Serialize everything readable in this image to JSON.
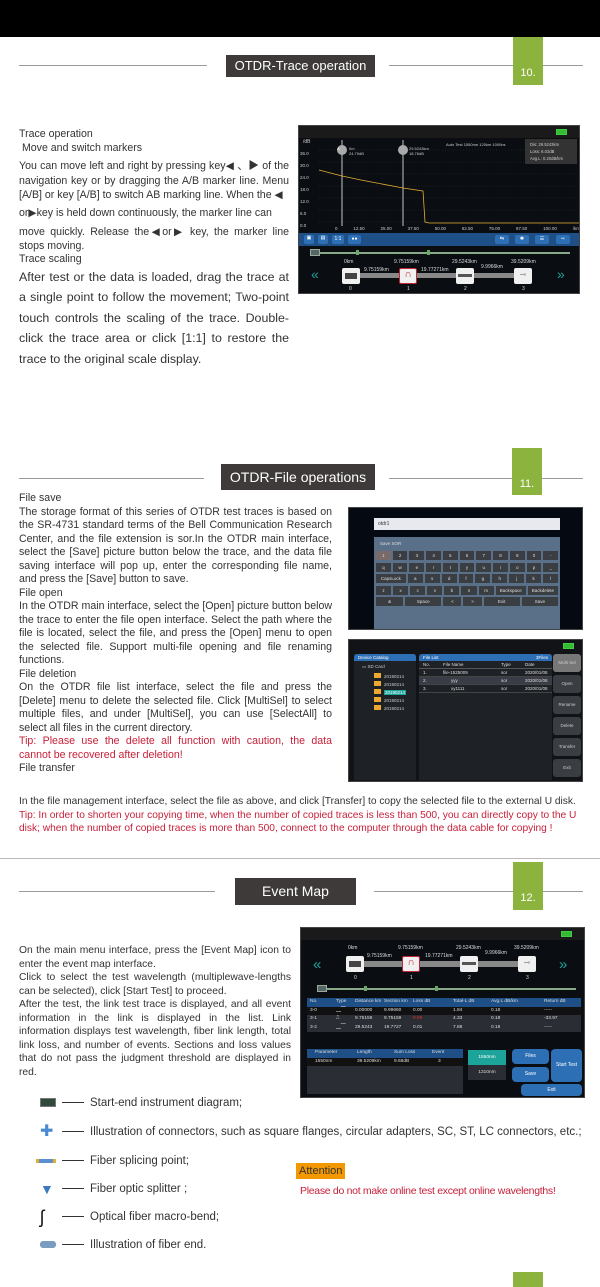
{
  "sections": [
    {
      "title": "OTDR-Trace operation",
      "page": "10."
    },
    {
      "title": "OTDR-File operations",
      "page": "11."
    },
    {
      "title": "Event Map",
      "page": "12."
    }
  ],
  "trace": {
    "h1": "Trace operation",
    "h2": " Move and switch markers",
    "p1": "You can move left and right by pressing key◀ 、▶ of the navigation key or by dragging the A/B marker line. Menu [A/B] or key [A/B] to switch AB marking line. When the ◀",
    "p2": "or▶key is held down continuously, the marker line can",
    "p3": "move quickly. Release the◀or▶ key, the marker line stops moving.",
    "h3": "Trace scaling",
    "p4": "After test or the data is loaded, drag the trace at a single point to follow the movement; Two-point touch controls the scaling of the trace. Double-click the trace area or click [1:1] to restore the trace to the original scale display."
  },
  "trace_screen": {
    "yunit": "/dB",
    "yticks": [
      "36.0",
      "30.0",
      "24.0",
      "18.0",
      "12.0",
      "6.0",
      "0.0"
    ],
    "xticks": [
      "0",
      "12.50",
      "25.00",
      "37.50",
      "50.00",
      "62.50",
      "75.00",
      "87.50",
      "100.00",
      "/km"
    ],
    "marker_a": {
      "label": "A",
      "dist": "0m",
      "loss": "24.79dB"
    },
    "marker_b": {
      "label": "B",
      "dist": "29.5243km",
      "loss": "18.76dB"
    },
    "test_info": "Auto Test  1550nm  120km  1000ns",
    "info_box": [
      "Dis: 29.5243km",
      "Loss: 6.03dB",
      "Avg.L: 0.20dB/km"
    ],
    "zoom_btn": "1:1",
    "colors": {
      "trace": "#e0b030",
      "marker": "#888888",
      "toolbar": "#1e4f86"
    }
  },
  "event_map": {
    "distances": [
      "0km",
      "9.75159km",
      "29.5243km",
      "39.5209km"
    ],
    "sections": [
      "9.75159km",
      "19.77271km",
      "9.9966km"
    ],
    "indices": [
      "0",
      "1",
      "2",
      "3"
    ]
  },
  "files": {
    "save_p": "File save",
    "p1": "The storage format of this series of OTDR test traces is based on the SR-4731 standard terms of the Bell Communication Research Center, and the file extension is sor.In the OTDR main interface, select the [Save] picture button below the trace, and the data file saving interface will pop up, enter the corresponding file name, and press the [Save] button to save.",
    "open_h": "File open",
    "p2": "In the OTDR main interface, select the [Open] picture button below the trace to enter the file open interface. Select the path where the file is located, select the file, and press the [Open] menu to open the selected file. Support multi-file opening and file renaming functions.",
    "del_h": "File deletion",
    "p3": "On the OTDR file list interface, select the file and press the [Delete] menu to delete the selected file. Click [MultiSel] to select multiple files, and under [MultiSel], you can use [SelectAll] to select all files in the current directory.",
    "tip1": "Tip: Please use the delete all function with caution, the data cannot be recovered after deletion!",
    "transfer_h": "File transfer",
    "p4": "In the file management interface, select the file as above, and click [Transfer] to copy the selected file to the external U disk.",
    "tip2": "Tip: In order to shorten your copying time, when the number of copied traces is less than 500, you can directly copy to the U disk; when the number of copied traces is more than 500, connect to the computer through the data cable for copying !"
  },
  "save_screen": {
    "filename": "otdr1",
    "title": "Save SOR",
    "rows": [
      [
        "1",
        "2",
        "3",
        "4",
        "5",
        "6",
        "7",
        "8",
        "9",
        "0",
        "-"
      ],
      [
        "q",
        "w",
        "e",
        "r",
        "t",
        "y",
        "u",
        "i",
        "o",
        "p",
        "_"
      ],
      [
        "CapsLock",
        "a",
        "s",
        "d",
        "f",
        "g",
        "h",
        "j",
        "k",
        "l"
      ],
      [
        "z",
        "x",
        "c",
        "v",
        "b",
        "n",
        "m",
        "Backspace",
        "Backdelete"
      ],
      [
        "&",
        "Space",
        "<",
        ">",
        "Exit",
        "Save"
      ]
    ]
  },
  "file_screen": {
    "catalog": "Device Catalog",
    "sd": "SD Card",
    "folders": [
      "20190214",
      "20190214",
      "20190214",
      "20190214",
      "20190214"
    ],
    "list_title": "File List",
    "count": "3Files",
    "headers": [
      "No.",
      "File Name",
      "Type",
      "Date"
    ],
    "rows": [
      [
        "1.",
        "file-1525009",
        "sor",
        "2020/01/08"
      ],
      [
        "2.",
        "yyy",
        "sor",
        "2020/01/08"
      ],
      [
        "3.",
        "xy1111",
        "sor",
        "2020/01/08"
      ]
    ],
    "buttons": [
      "Multi Sel",
      "Open",
      "Rename",
      "Delete",
      "Transfer",
      "Exit"
    ]
  },
  "event": {
    "p": "On the main menu interface, press the [Event Map] icon to enter the event map interface.\nClick to select the test wavelength (multiplewave-lengths can be selected), click [Start Test] to proceed.\nAfter the test, the link test trace is displayed, and all event information in the link is displayed in the list. Link information displays test wavelength, fiber link length, total link loss, and number of events. Sections and loss values that do not pass the judgment threshold are displayed in red.",
    "headers": [
      "No.",
      "Type",
      "Distance km",
      "Section km",
      "Loss dB",
      "Total-L dB",
      "Avg.L dB/km",
      "Return dB"
    ],
    "rows": [
      [
        "3-0",
        "",
        "0.00000",
        "9.99660",
        "0.00",
        "1.84",
        "0.18",
        "-----"
      ],
      [
        "3-1",
        "",
        "9.75159",
        "9.75159",
        "0.69",
        "4.33",
        "0.18",
        "-33.97"
      ],
      [
        "3-2",
        "",
        "29.5243",
        "19.7727",
        "0.01",
        "7.88",
        "0.18",
        "-----"
      ]
    ],
    "param_headers": [
      "Parameter",
      "Length",
      "Sum Loss",
      "Event"
    ],
    "param_row": [
      "1550nm",
      "39.5209km",
      "9.68dB",
      "3"
    ],
    "wl": [
      "1550nm",
      "1310nm"
    ],
    "btns": {
      "files": "Files",
      "save": "Save",
      "start": "Start Test",
      "exit": "Exit"
    },
    "legend": [
      "Start-end instrument diagram;",
      "Illustration of connectors, such as square flanges, circular adapters, SC, ST, LC connectors, etc.;",
      "Fiber splicing point;",
      "Fiber optic splitter ;",
      "Optical fiber macro-bend;",
      "Illustration of fiber end."
    ],
    "attention": "Attention",
    "warning": "Please do not make online test except online wavelengths!"
  }
}
